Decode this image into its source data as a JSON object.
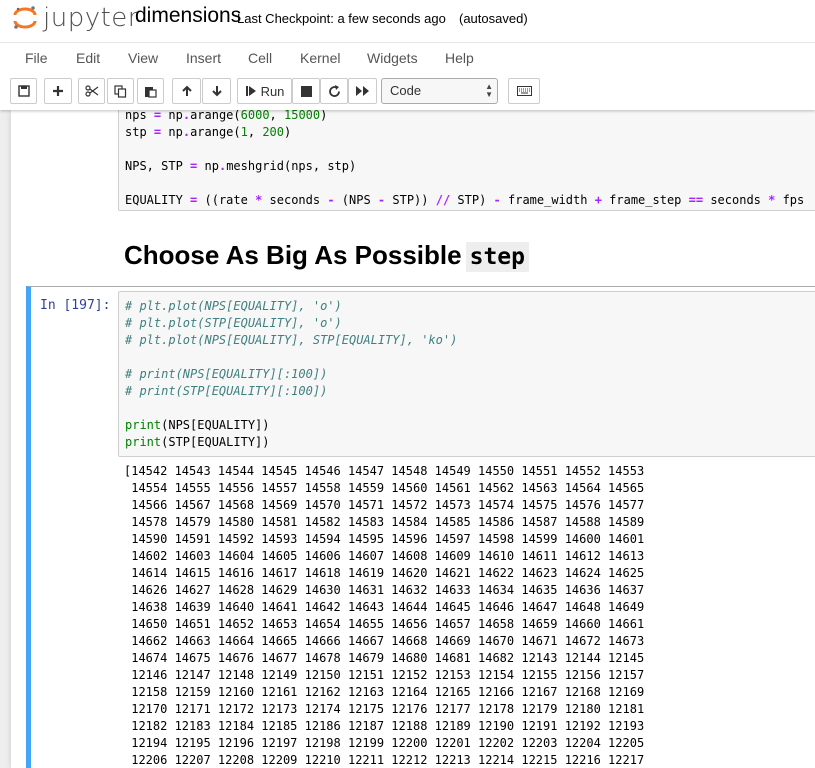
{
  "header": {
    "logo_text": "jupyter",
    "notebook_name": "dimensions",
    "checkpoint": "Last Checkpoint: a few seconds ago",
    "autosave": "(autosaved)"
  },
  "menu": [
    "File",
    "Edit",
    "View",
    "Insert",
    "Cell",
    "Kernel",
    "Widgets",
    "Help"
  ],
  "toolbar": {
    "run_label": "Run",
    "cell_type": "Code",
    "icons": [
      "save-icon",
      "plus-icon",
      "cut-icon",
      "copy-icon",
      "paste-icon",
      "arrow-up-icon",
      "arrow-down-icon",
      "run-icon",
      "stop-icon",
      "restart-icon",
      "fast-forward-icon",
      "keyboard-icon"
    ]
  },
  "cell1": {
    "lines": [
      "nps = np.arange(6000, 15000)",
      "stp = np.arange(1, 200)",
      "",
      "NPS, STP = np.meshgrid(nps, stp)",
      "",
      "EQUALITY = ((rate * seconds - (NPS - STP)) // STP) - frame_width + frame_step == seconds * fps"
    ]
  },
  "markdown": {
    "heading": "Choose As Big As Possible",
    "inline_code": "step"
  },
  "cell2": {
    "prompt": "In [197]:",
    "lines": [
      "# plt.plot(NPS[EQUALITY], 'o')",
      "# plt.plot(STP[EQUALITY], 'o')",
      "# plt.plot(NPS[EQUALITY], STP[EQUALITY], 'ko')",
      "",
      "# print(NPS[EQUALITY][:100])",
      "# print(STP[EQUALITY][:100])",
      "",
      "print(NPS[EQUALITY])",
      "print(STP[EQUALITY])"
    ]
  },
  "output": {
    "lines": [
      "[14542 14543 14544 14545 14546 14547 14548 14549 14550 14551 14552 14553",
      " 14554 14555 14556 14557 14558 14559 14560 14561 14562 14563 14564 14565",
      " 14566 14567 14568 14569 14570 14571 14572 14573 14574 14575 14576 14577",
      " 14578 14579 14580 14581 14582 14583 14584 14585 14586 14587 14588 14589",
      " 14590 14591 14592 14593 14594 14595 14596 14597 14598 14599 14600 14601",
      " 14602 14603 14604 14605 14606 14607 14608 14609 14610 14611 14612 14613",
      " 14614 14615 14616 14617 14618 14619 14620 14621 14622 14623 14624 14625",
      " 14626 14627 14628 14629 14630 14631 14632 14633 14634 14635 14636 14637",
      " 14638 14639 14640 14641 14642 14643 14644 14645 14646 14647 14648 14649",
      " 14650 14651 14652 14653 14654 14655 14656 14657 14658 14659 14660 14661",
      " 14662 14663 14664 14665 14666 14667 14668 14669 14670 14671 14672 14673",
      " 14674 14675 14676 14677 14678 14679 14680 14681 14682 12143 12144 12145",
      " 12146 12147 12148 12149 12150 12151 12152 12153 12154 12155 12156 12157",
      " 12158 12159 12160 12161 12162 12163 12164 12165 12166 12167 12168 12169",
      " 12170 12171 12172 12173 12174 12175 12176 12177 12178 12179 12180 12181",
      " 12182 12183 12184 12185 12186 12187 12188 12189 12190 12191 12192 12193",
      " 12194 12195 12196 12197 12198 12199 12200 12201 12202 12203 12204 12205",
      " 12206 12207 12208 12209 12210 12211 12212 12213 12214 12215 12216 12217"
    ]
  }
}
